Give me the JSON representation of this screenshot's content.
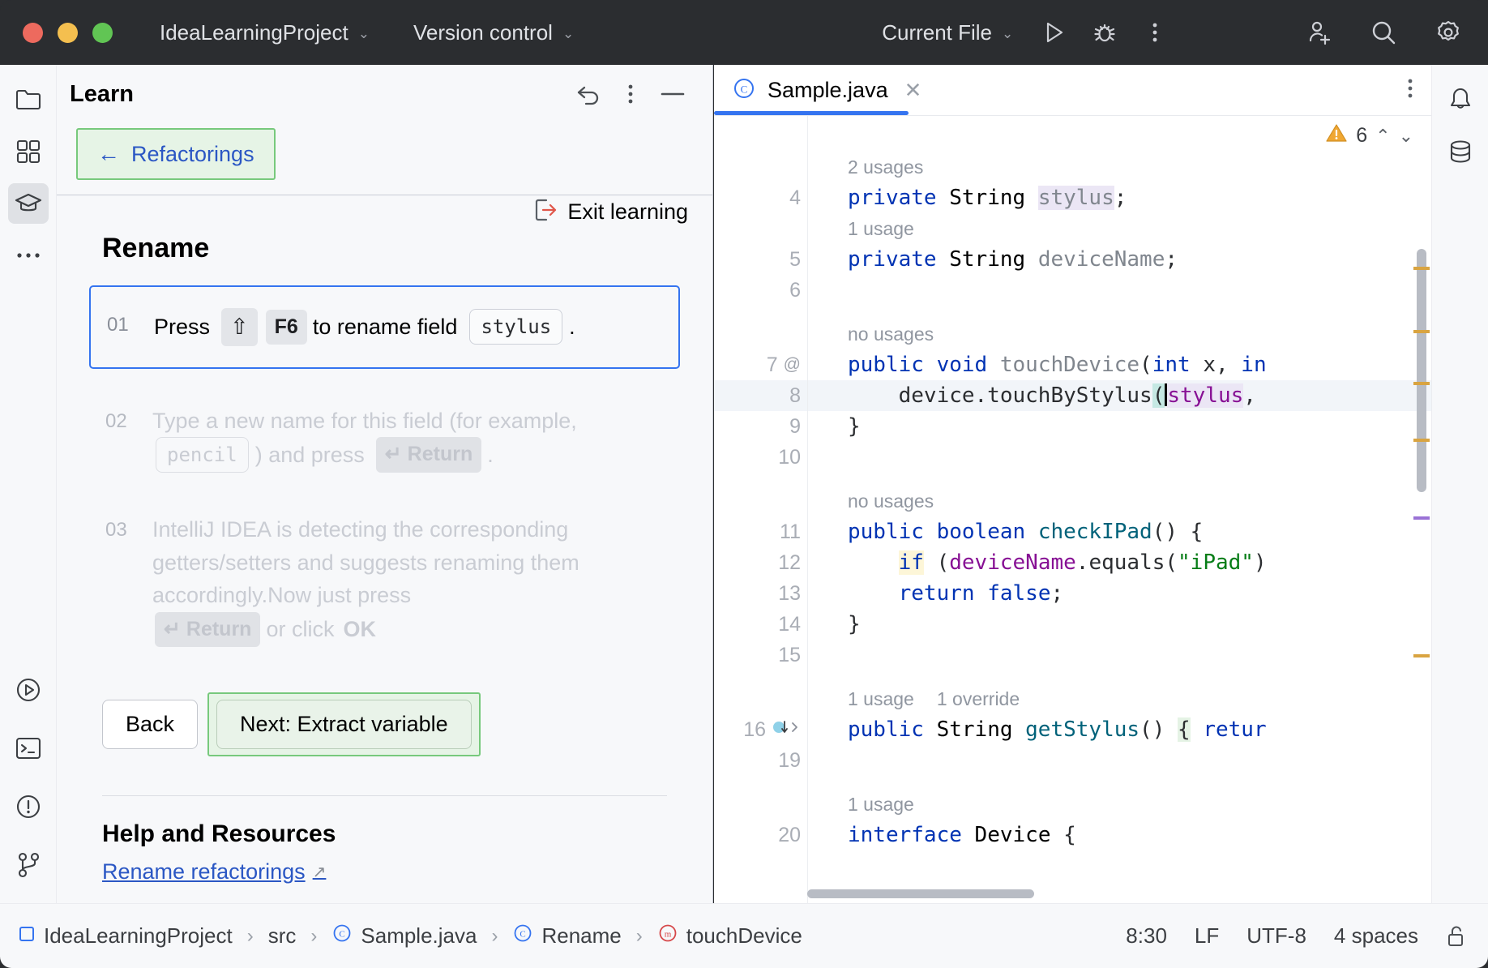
{
  "titlebar": {
    "project_name": "IdeaLearningProject",
    "vcs_label": "Version control",
    "run_config": "Current File",
    "icons": [
      "run-icon",
      "debug-icon",
      "more-icon",
      "add-collaborator-icon",
      "search-icon",
      "settings-icon"
    ]
  },
  "learn": {
    "panel_title": "Learn",
    "back_label": "Refactorings",
    "back_arrow": "←",
    "exit_label": "Exit learning",
    "lesson_title": "Rename",
    "steps": [
      {
        "num": "01",
        "state": "active",
        "parts": [
          {
            "type": "text",
            "value": "Press"
          },
          {
            "type": "kbd",
            "value": "⇧"
          },
          {
            "type": "kbd",
            "value": "F6"
          },
          {
            "type": "text",
            "value": "to rename field"
          },
          {
            "type": "code",
            "value": "stylus"
          },
          {
            "type": "text",
            "value": "."
          }
        ]
      },
      {
        "num": "02",
        "state": "dim",
        "parts": [
          {
            "type": "text",
            "value": "Type a new name for this field (for example,"
          },
          {
            "type": "code",
            "value": "pencil"
          },
          {
            "type": "text",
            "value": ") and press"
          },
          {
            "type": "kbd",
            "value": "↵ Return"
          },
          {
            "type": "text",
            "value": "."
          }
        ]
      },
      {
        "num": "03",
        "state": "dim",
        "parts": [
          {
            "type": "text",
            "value": "IntelliJ IDEA is detecting the corresponding getters/setters and suggests renaming them accordingly.Now just press"
          },
          {
            "type": "kbd",
            "value": "↵ Return"
          },
          {
            "type": "text",
            "value": "or click"
          },
          {
            "type": "bold",
            "value": "OK"
          }
        ]
      }
    ],
    "back_button": "Back",
    "next_button": "Next: Extract variable",
    "help_title": "Help and Resources",
    "help_link": "Rename refactorings",
    "help_link_arrow": "↗"
  },
  "editor": {
    "tab_name": "Sample.java",
    "tab_icon": "java-class-icon",
    "close_icon": "close-icon",
    "warning_count": "6",
    "warning_icon": "warning-triangle-icon",
    "rows": [
      {
        "kind": "hint",
        "text": "2 usages"
      },
      {
        "kind": "code",
        "num": "4",
        "mark": "",
        "html": "kw:private| |cls:String| |hlstylus:stylus|;"
      },
      {
        "kind": "hint",
        "text": "1 usage"
      },
      {
        "kind": "code",
        "num": "5",
        "mark": "",
        "html": "kw:private| |cls:String| |gry:deviceName|;"
      },
      {
        "kind": "code",
        "num": "6",
        "mark": "",
        "html": ""
      },
      {
        "kind": "blank",
        "text": ""
      },
      {
        "kind": "hint",
        "text": "no usages"
      },
      {
        "kind": "code",
        "num": "7",
        "mark": "@",
        "html": "kw:public| kw:void| gry:touchDevice|(kw:int| x, kw:in"
      },
      {
        "kind": "code",
        "num": "8",
        "mark": "",
        "hl": true,
        "html": "    device.touchByStylus(stylus,"
      },
      {
        "kind": "code",
        "num": "9",
        "mark": "",
        "html": "}"
      },
      {
        "kind": "code",
        "num": "10",
        "mark": "",
        "html": ""
      },
      {
        "kind": "blank",
        "text": ""
      },
      {
        "kind": "hint",
        "text": "no usages"
      },
      {
        "kind": "code",
        "num": "11",
        "mark": "",
        "html": "kw:public| kw:boolean| mth:checkIPad|() {"
      },
      {
        "kind": "code",
        "num": "12",
        "mark": "",
        "html": "    if (deviceName.equals(\"iPad\")"
      },
      {
        "kind": "code",
        "num": "13",
        "mark": "",
        "html": "    kw:return| kw:false|;"
      },
      {
        "kind": "code",
        "num": "14",
        "mark": "",
        "html": "}"
      },
      {
        "kind": "code",
        "num": "15",
        "mark": "",
        "html": ""
      },
      {
        "kind": "blank",
        "text": ""
      },
      {
        "kind": "hint2",
        "text": "1 usage",
        "text2": "1 override"
      },
      {
        "kind": "code",
        "num": "16",
        "mark": "override",
        "html": "kw:public| cls:String| mth:getStylus|() { kw:retur"
      },
      {
        "kind": "code",
        "num": "19",
        "mark": "",
        "html": ""
      },
      {
        "kind": "blank",
        "text": ""
      },
      {
        "kind": "hint",
        "text": "1 usage"
      },
      {
        "kind": "code",
        "num": "20",
        "mark": "",
        "html": "kw:interface| cls:Device| {"
      }
    ]
  },
  "status": {
    "breadcrumb": [
      {
        "icon": "module-icon",
        "label": "IdeaLearningProject"
      },
      {
        "icon": "",
        "label": "src"
      },
      {
        "icon": "java-class-icon",
        "label": "Sample.java"
      },
      {
        "icon": "java-class-icon",
        "label": "Rename"
      },
      {
        "icon": "method-icon",
        "label": "touchDevice"
      }
    ],
    "separator": "›",
    "caret_position": "8:30",
    "line_separator": "LF",
    "encoding": "UTF-8",
    "indent": "4 spaces",
    "lock_icon": "unlocked-icon"
  },
  "colors": {
    "accent": "#3574f0",
    "green_highlight": "#77c97c",
    "link": "#2b57c4",
    "keyword": "#0033b3",
    "field": "#871094",
    "string": "#067d17",
    "method": "#00627a"
  }
}
